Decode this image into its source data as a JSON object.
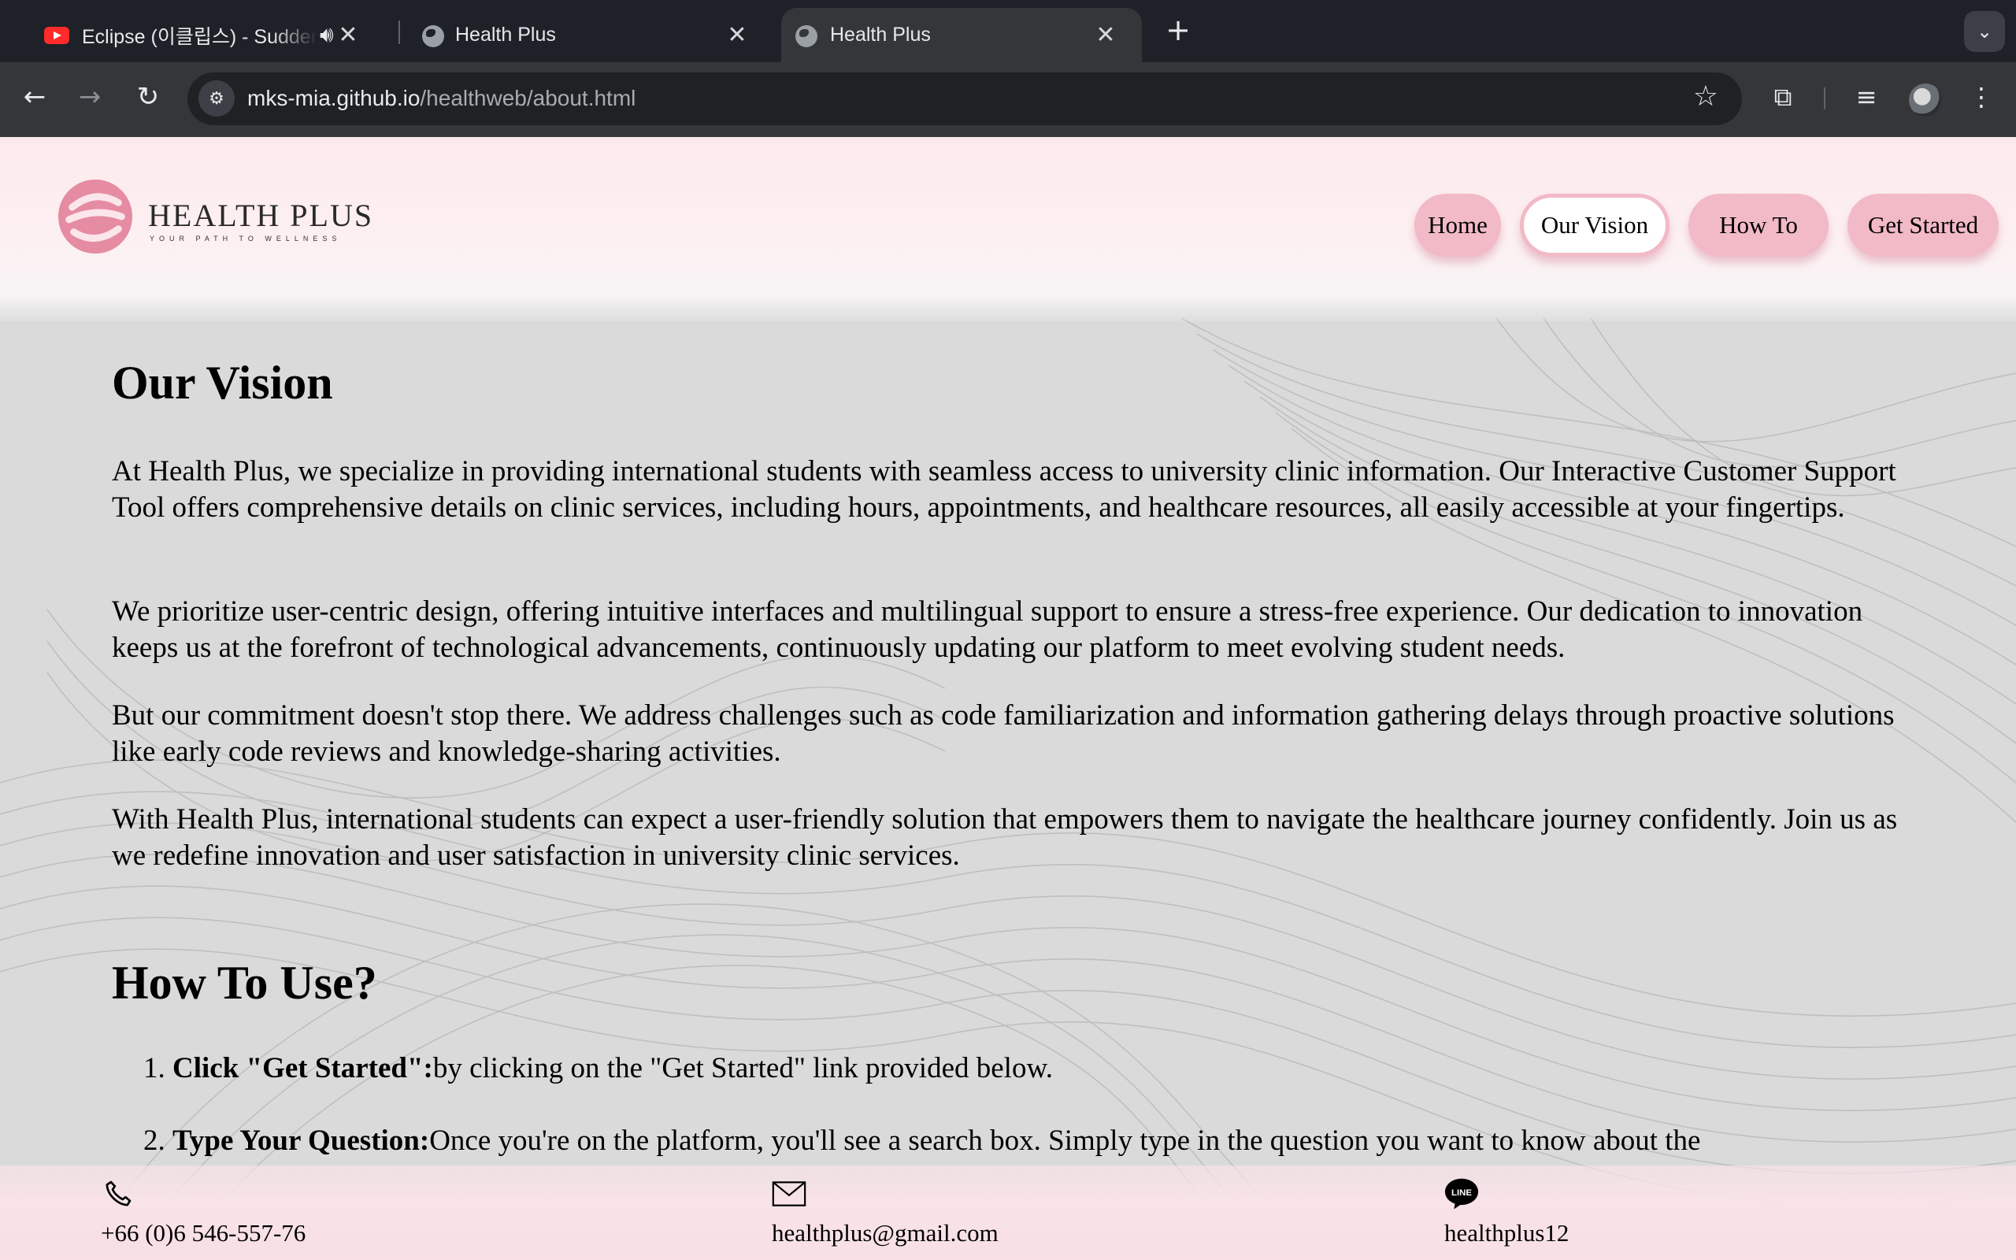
{
  "browser": {
    "tabs": [
      {
        "title": "Eclipse (이클립스) - Sudden",
        "icon": "youtube-icon",
        "audio": true
      },
      {
        "title": "Health Plus",
        "icon": "globe-icon"
      },
      {
        "title": "Health Plus",
        "icon": "globe-icon",
        "active": true
      }
    ],
    "url_host": "mks-mia.github.io",
    "url_path": "/healthweb/about.html"
  },
  "site": {
    "logo_name": "HEALTH PLUS",
    "logo_tagline": "YOUR PATH TO WELLNESS",
    "brand_color": "#f2b9c6",
    "nav": [
      {
        "label": "Home"
      },
      {
        "label": "Our Vision",
        "active": true
      },
      {
        "label": "How To"
      },
      {
        "label": "Get Started"
      }
    ]
  },
  "vision": {
    "heading": "Our Vision",
    "paragraphs": [
      "At Health Plus, we specialize in providing international students with seamless access to university clinic information. Our Interactive Customer Support Tool offers comprehensive details on clinic services, including hours, appointments, and healthcare resources, all easily accessible at your fingertips.",
      "We prioritize user-centric design, offering intuitive interfaces and multilingual support to ensure a stress-free experience. Our dedication to innovation keeps us at the forefront of technological advancements, continuously updating our platform to meet evolving student needs.",
      "But our commitment doesn't stop there. We address challenges such as code familiarization and information gathering delays through proactive solutions like early code reviews and knowledge-sharing activities.",
      "With Health Plus, international students can expect a user-friendly solution that empowers them to navigate the healthcare journey confidently. Join us as we redefine innovation and user satisfaction in university clinic services."
    ]
  },
  "howto": {
    "heading": "How To Use?",
    "steps": [
      {
        "num": "1.",
        "title": "Click \"Get Started\":",
        "text": "by clicking on the \"Get Started\" link provided below."
      },
      {
        "num": "2.",
        "title": "Type Your Question:",
        "text": "Once you're on the platform, you'll see a search box. Simply type in the question you want to know about the"
      }
    ]
  },
  "footer": {
    "phone": "+66 (0)6 546-557-76",
    "email": "healthplus@gmail.com",
    "line": "healthplus12",
    "line_icon_text": "LINE"
  }
}
